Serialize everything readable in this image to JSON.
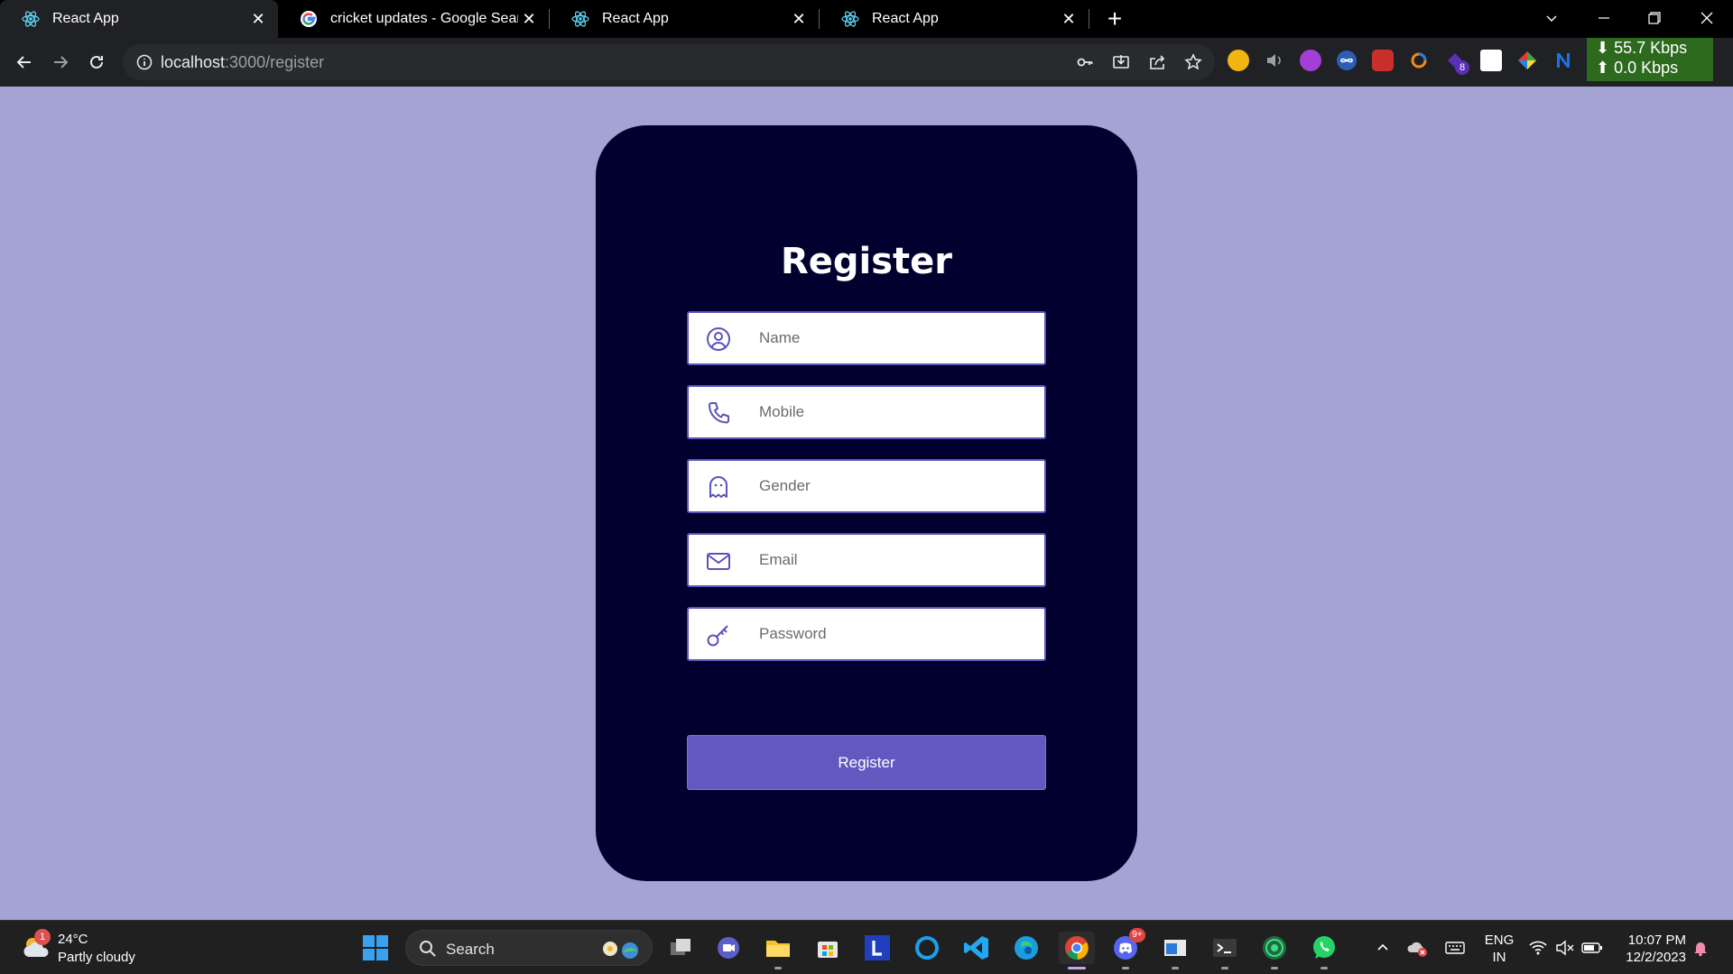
{
  "browser": {
    "tabs": [
      {
        "title": "React App",
        "favicon": "react-icon",
        "active": true
      },
      {
        "title": "cricket updates - Google Search",
        "favicon": "google-icon",
        "active": false
      },
      {
        "title": "React App",
        "favicon": "react-icon",
        "active": false
      },
      {
        "title": "React App",
        "favicon": "react-icon",
        "active": false
      }
    ],
    "url_host": "localhost",
    "url_rest": ":3000/register",
    "net_speed": {
      "down": "55.7 Kbps",
      "up": "0.0 Kbps"
    }
  },
  "page": {
    "background": "#a5a3d4",
    "card_color": "#02002f",
    "accent": "#6159bf",
    "title": "Register",
    "fields": [
      {
        "placeholder": "Name",
        "icon": "user-circle-icon"
      },
      {
        "placeholder": "Mobile",
        "icon": "phone-icon"
      },
      {
        "placeholder": "Gender",
        "icon": "ghost-icon"
      },
      {
        "placeholder": "Email",
        "icon": "mail-icon"
      },
      {
        "placeholder": "Password",
        "icon": "key-icon"
      }
    ],
    "submit_label": "Register"
  },
  "taskbar": {
    "weather": {
      "temp": "24°C",
      "condition": "Partly cloudy",
      "badge": "1"
    },
    "search_label": "Search",
    "discord_badge": "9+",
    "extension_badge": "8",
    "lang_top": "ENG",
    "lang_bottom": "IN",
    "time": "10:07 PM",
    "date": "12/2/2023"
  }
}
